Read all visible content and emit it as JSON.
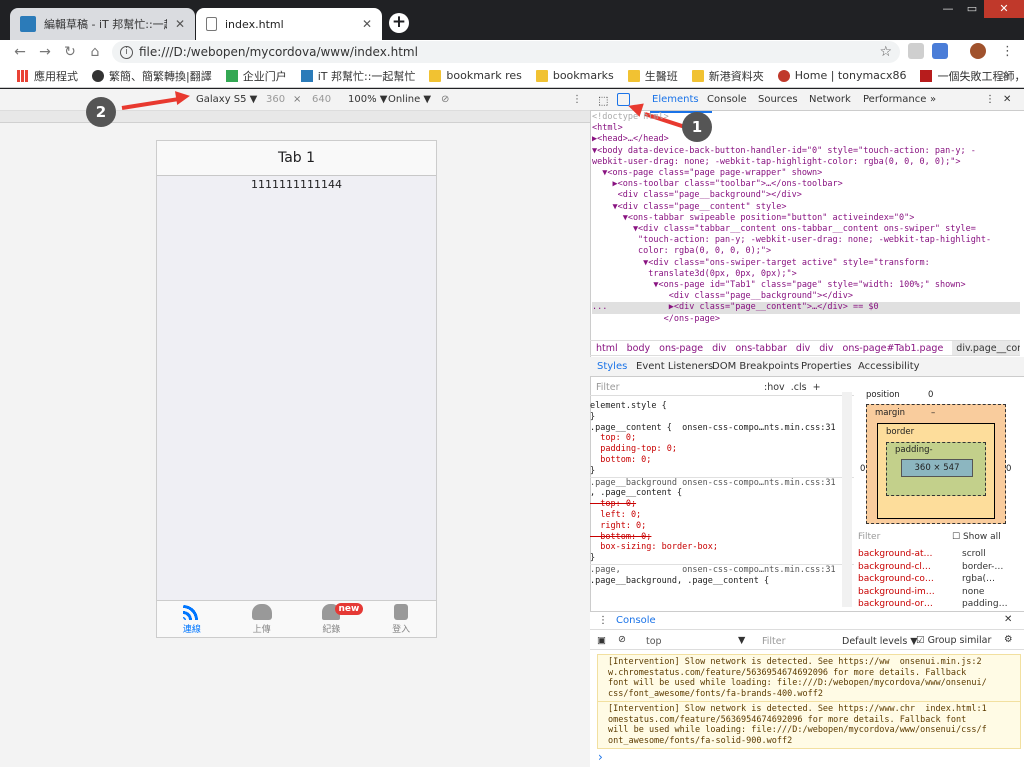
{
  "browser": {
    "tabs": [
      {
        "title": "編輯草稿 - iT 邦幫忙::一起幫忙解"
      },
      {
        "title": "index.html"
      }
    ],
    "new_tab_label": "+",
    "window_controls": [
      "—",
      "▭",
      "✕"
    ],
    "address": "file:///D:/webopen/mycordova/www/index.html",
    "bookmarks": [
      "應用程式",
      "繁簡、簡繁轉換|翻譯",
      "企业门户",
      "iT 邦幫忙::一起幫忙",
      "bookmark res",
      "bookmarks",
      "生醫班",
      "新港資料夾",
      "Home | tonymacx86",
      "一個失敗工程師，劉"
    ],
    "bookmark_more": "»"
  },
  "device_toolbar": {
    "device": "Galaxy S5 ▼",
    "width": "360",
    "times": "×",
    "height": "640",
    "zoom": "100% ▼",
    "network": "Online ▼"
  },
  "phone": {
    "header_title": "Tab 1",
    "content_text": "1111111111144",
    "tabs": [
      {
        "label": "連線",
        "icon": "rss-icon"
      },
      {
        "label": "上傳",
        "icon": "cloud-upload-icon"
      },
      {
        "label": "紀錄",
        "icon": "heartbeat-icon",
        "badge": "new"
      },
      {
        "label": "登入",
        "icon": "id-card-icon"
      }
    ]
  },
  "annotations": {
    "callout1": "1",
    "callout2": "2"
  },
  "devtools": {
    "tabs": [
      "Elements",
      "Console",
      "Sources",
      "Network",
      "Performance"
    ],
    "more": "»",
    "dom": [
      "<!doctype html>",
      "<html>",
      "▶<head>…</head>",
      "▼<body data-device-back-button-handler-id=\"0\" style=\"touch-action: pan-y; -",
      "webkit-user-drag: none; -webkit-tap-highlight-color: rgba(0, 0, 0, 0);\">",
      "  ▼<ons-page class=\"page page-wrapper\" shown>",
      "    ▶<ons-toolbar class=\"toolbar\">…</ons-toolbar>",
      "     <div class=\"page__background\"></div>",
      "    ▼<div class=\"page__content\" style>",
      "      ▼<ons-tabbar swipeable position=\"button\" activeindex=\"0\">",
      "        ▼<div class=\"tabbar__content ons-tabbar__content ons-swiper\" style=",
      "         \"touch-action: pan-y; -webkit-user-drag: none; -webkit-tap-highlight-",
      "         color: rgba(0, 0, 0, 0);\">",
      "          ▼<div class=\"ons-swiper-target active\" style=\"transform:",
      "           translate3d(0px, 0px, 0px);\">",
      "            ▼<ons-page id=\"Tab1\" class=\"page\" style=\"width: 100%;\" shown>",
      "               <div class=\"page__background\"></div>",
      "...            ▶<div class=\"page__content\">…</div> == $0",
      "              </ons-page>"
    ],
    "breadcrumbs": [
      "html",
      "body",
      "ons-page",
      "div",
      "ons-tabbar",
      "div",
      "div",
      "ons-page#Tab1.page",
      "div.page__content"
    ],
    "subtabs": [
      "Styles",
      "Event Listeners",
      "DOM Breakpoints",
      "Properties",
      "Accessibility"
    ],
    "filter_placeholder": "Filter",
    "hov_cls": ":hov  .cls  +",
    "styles": [
      "element.style {",
      "}",
      ".page__content {  onsen-css-compo…nts.min.css:31",
      "  top: 0;",
      "  padding-top: 0;",
      "  bottom: 0;",
      "}",
      ".page__background onsen-css-compo…nts.min.css:31",
      ", .page__content {",
      "  top: 0;",
      "  left: 0;",
      "  right: 0;",
      "  bottom: 0;",
      "  box-sizing: border-box;",
      "}",
      ".page,            onsen-css-compo…nts.min.css:31",
      ".page__background, .page__content {"
    ],
    "boxmodel": {
      "position": "position",
      "pos_val": "0",
      "margin": "margin",
      "border": "border",
      "padding": "padding-",
      "size": "360 × 547",
      "dash": "–",
      "zero": "0"
    },
    "computed_filter": "Filter",
    "show_all": "Show all",
    "computed": [
      [
        "background-at…",
        "scroll"
      ],
      [
        "background-cl…",
        "border-…"
      ],
      [
        "background-co…",
        "rgba(…"
      ],
      [
        "background-im…",
        "none"
      ],
      [
        "background-or…",
        "padding…"
      ]
    ],
    "console": {
      "title": "Console",
      "context": "top",
      "filter": "Filter",
      "levels": "Default levels ▼",
      "group": "Group similar",
      "msg1": [
        "[Intervention] Slow network is detected. See https://ww  onsenui.min.js:2",
        "w.chromestatus.com/feature/5636954674692096 for more details. Fallback",
        "font will be used while loading: file:///D:/webopen/mycordova/www/onsenui/",
        "css/font_awesome/fonts/fa-brands-400.woff2"
      ],
      "msg2": [
        "[Intervention] Slow network is detected. See https://www.chr  index.html:1",
        "omestatus.com/feature/5636954674692096 for more details. Fallback font",
        "will be used while loading: file:///D:/webopen/mycordova/www/onsenui/css/f",
        "ont_awesome/fonts/fa-solid-900.woff2"
      ],
      "prompt": "›"
    }
  },
  "colors": {
    "accent": "#0076ff",
    "arrow": "#e8392f",
    "badge": "#e53935"
  }
}
